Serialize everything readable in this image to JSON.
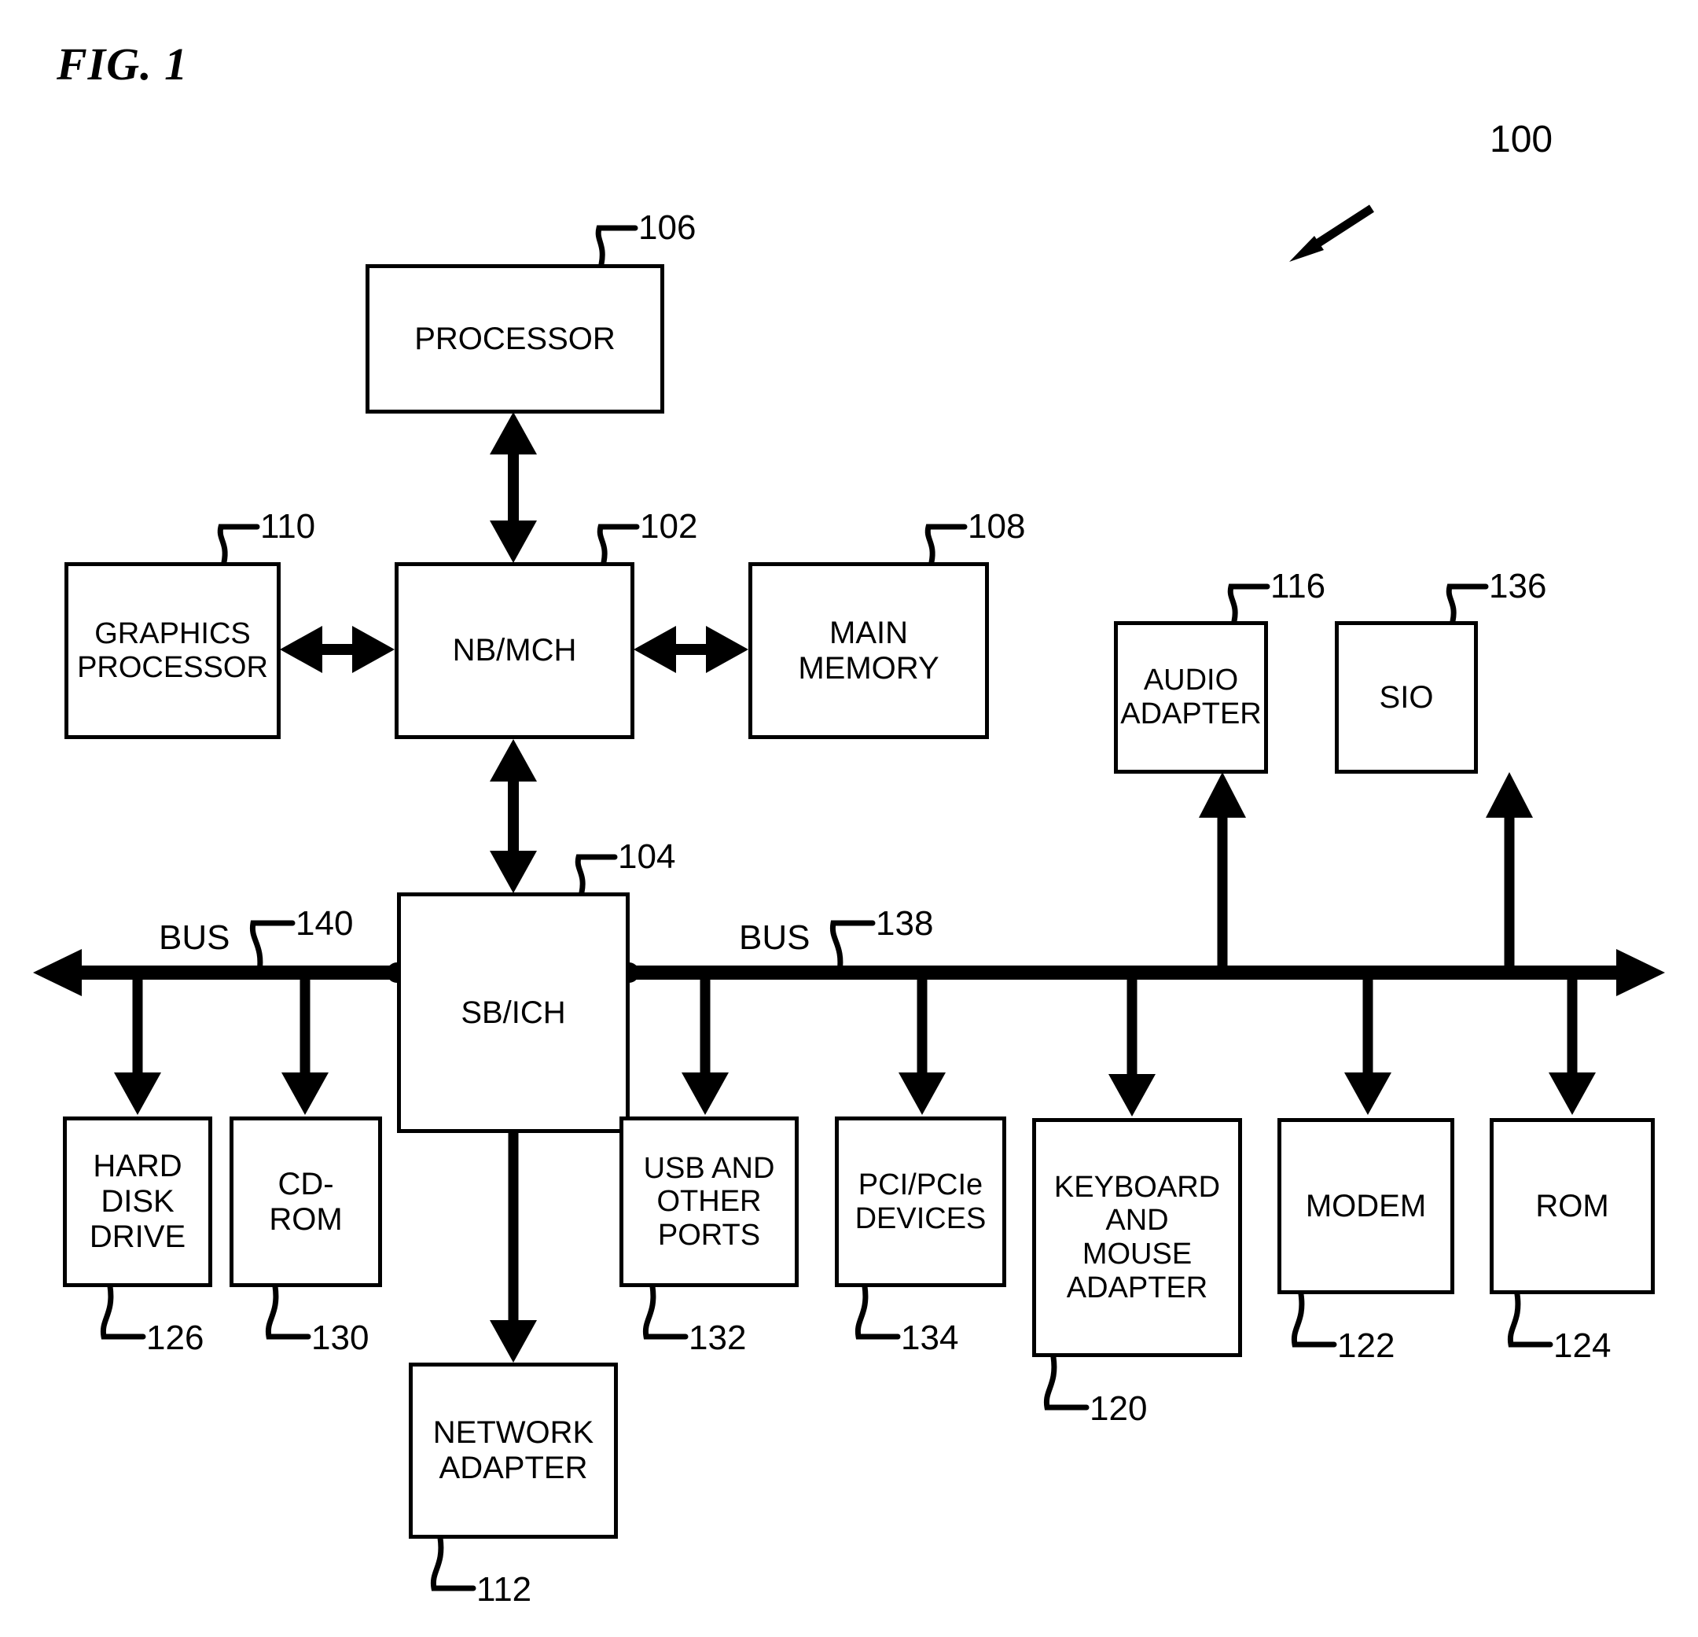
{
  "figure": {
    "title": "FIG. 1",
    "system_ref": "100"
  },
  "nodes": [
    {
      "id": "processor",
      "label": "PROCESSOR",
      "ref": "106",
      "ref_pos": "top-right"
    },
    {
      "id": "graphics",
      "label": "GRAPHICS\nPROCESSOR",
      "ref": "110",
      "ref_pos": "top-right"
    },
    {
      "id": "nbmch",
      "label": "NB/MCH",
      "ref": "102",
      "ref_pos": "top-right"
    },
    {
      "id": "main_memory",
      "label": "MAIN\nMEMORY",
      "ref": "108",
      "ref_pos": "top-right"
    },
    {
      "id": "audio_adapter",
      "label": "AUDIO\nADAPTER",
      "ref": "116",
      "ref_pos": "top-right"
    },
    {
      "id": "sio",
      "label": "SIO",
      "ref": "136",
      "ref_pos": "top-right"
    },
    {
      "id": "sbich",
      "label": "SB/ICH",
      "ref": "104",
      "ref_pos": "top-right"
    },
    {
      "id": "hdd",
      "label": "HARD\nDISK\nDRIVE",
      "ref": "126",
      "ref_pos": "bottom-left"
    },
    {
      "id": "cdrom",
      "label": "CD-\nROM",
      "ref": "130",
      "ref_pos": "bottom-left"
    },
    {
      "id": "network",
      "label": "NETWORK\nADAPTER",
      "ref": "112",
      "ref_pos": "bottom-left"
    },
    {
      "id": "usb",
      "label": "USB AND\nOTHER\nPORTS",
      "ref": "132",
      "ref_pos": "bottom-left"
    },
    {
      "id": "pci",
      "label": "PCI/PCIe\nDEVICES",
      "ref": "134",
      "ref_pos": "bottom-left"
    },
    {
      "id": "keyboard",
      "label": "KEYBOARD\nAND\nMOUSE\nADAPTER",
      "ref": "120",
      "ref_pos": "bottom-left"
    },
    {
      "id": "modem",
      "label": "MODEM",
      "ref": "122",
      "ref_pos": "bottom-left"
    },
    {
      "id": "rom",
      "label": "ROM",
      "ref": "124",
      "ref_pos": "bottom-left"
    }
  ],
  "buses": [
    {
      "id": "bus_left",
      "label": "BUS",
      "ref": "140"
    },
    {
      "id": "bus_right",
      "label": "BUS",
      "ref": "138"
    }
  ]
}
